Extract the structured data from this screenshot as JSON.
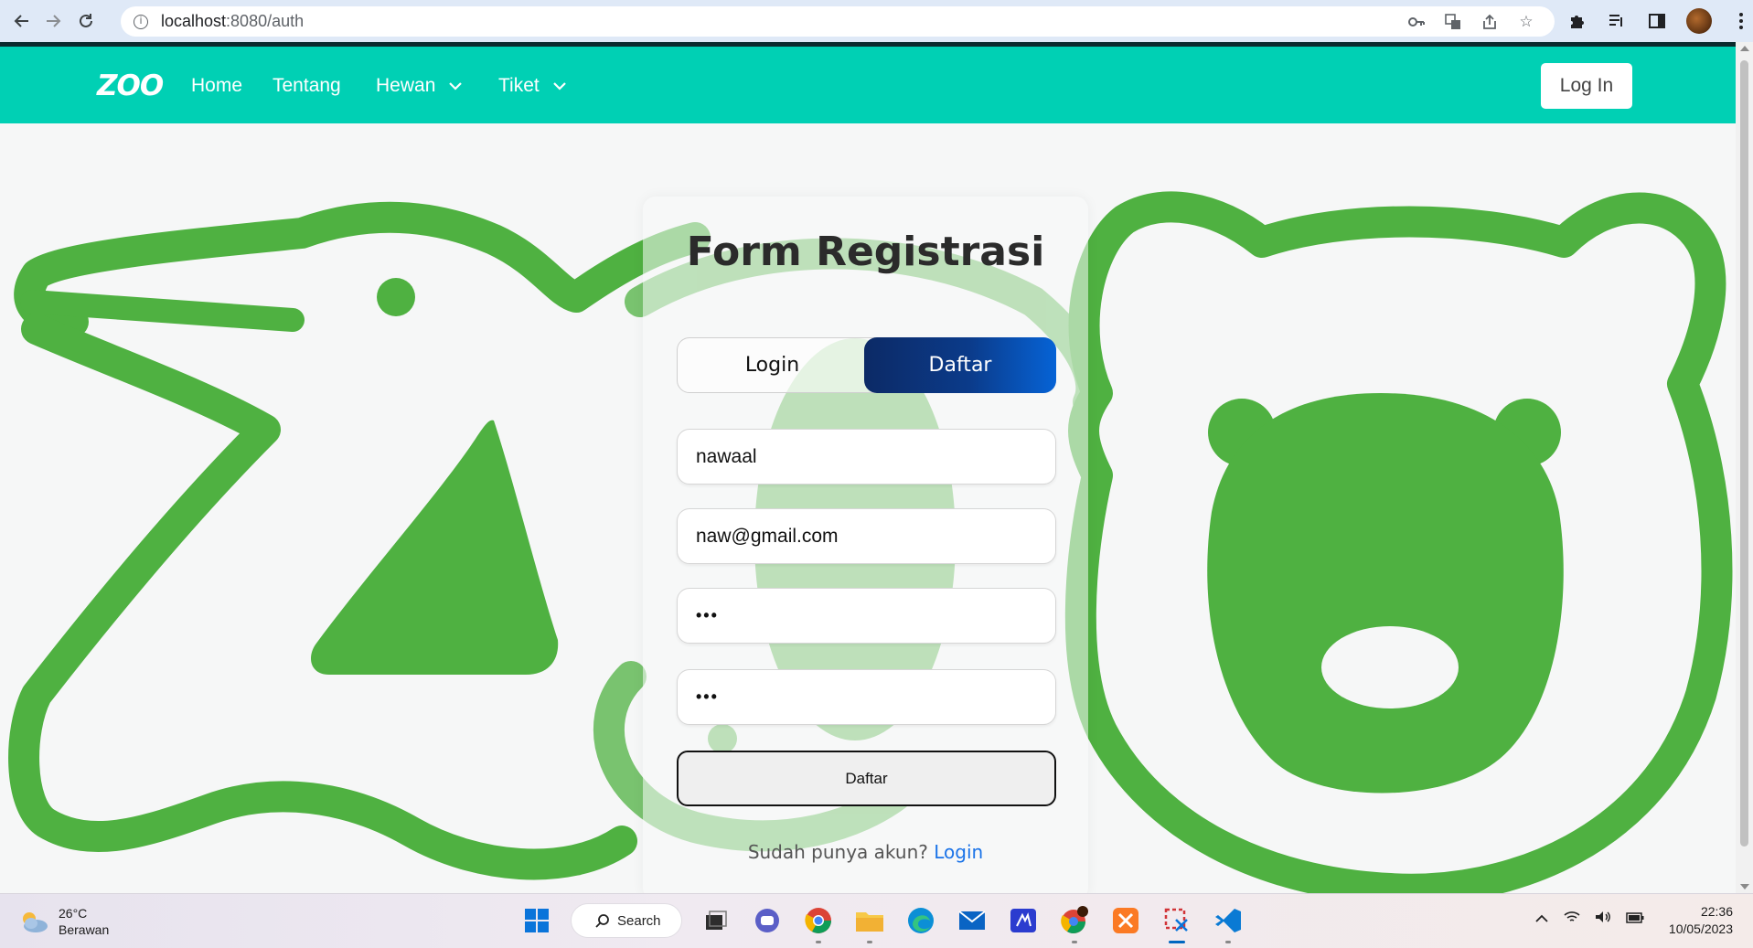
{
  "browser": {
    "url_host": "localhost",
    "url_rest": ":8080/auth",
    "icons": [
      "back-icon",
      "forward-icon",
      "reload-icon",
      "site-info-icon",
      "key-icon",
      "translate-icon",
      "share-icon",
      "star-icon",
      "extensions-icon",
      "reading-list-icon",
      "side-panel-icon",
      "profile-avatar",
      "menu-icon"
    ]
  },
  "navbar": {
    "logo": "ZOO",
    "links": [
      {
        "label": "Home"
      },
      {
        "label": "Tentang"
      },
      {
        "label": "Hewan",
        "dropdown": true
      },
      {
        "label": "Tiket",
        "dropdown": true
      }
    ],
    "login_button": "Log In",
    "color": "#00d0b4"
  },
  "form": {
    "title": "Form Registrasi",
    "tab_login": "Login",
    "tab_daftar": "Daftar",
    "active_tab": "Daftar",
    "username_value": "nawaal",
    "email_value": "naw@gmail.com",
    "password_value": "•••",
    "confirm_password_value": "•••",
    "submit_label": "Daftar",
    "footer_prefix": "Sudah punya akun? ",
    "footer_link": "Login",
    "accent_gradient": [
      "#0c2a66",
      "#0663d6"
    ]
  },
  "taskbar": {
    "weather_temp": "26°C",
    "weather_desc": "Berawan",
    "search_label": "Search",
    "apps": [
      "start",
      "search",
      "task-view",
      "chat",
      "chrome",
      "file-explorer",
      "edge",
      "mail",
      "app-9",
      "chrome-profile",
      "xampp",
      "snipping-tool",
      "vscode"
    ],
    "time": "22:36",
    "date": "10/05/2023"
  }
}
